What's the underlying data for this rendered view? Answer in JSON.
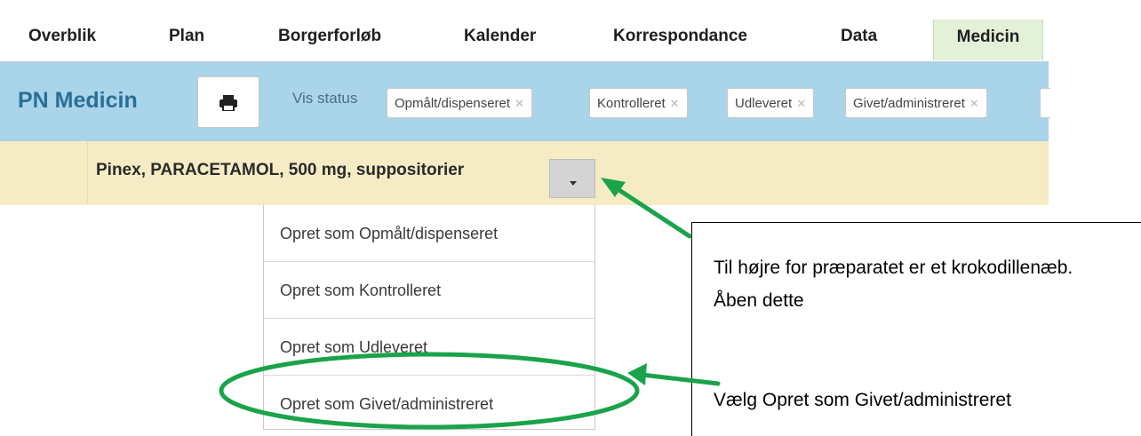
{
  "topnav": {
    "tabs": [
      {
        "label": "Overblik"
      },
      {
        "label": "Plan"
      },
      {
        "label": "Borgerforløb"
      },
      {
        "label": "Kalender"
      },
      {
        "label": "Korrespondance"
      },
      {
        "label": "Data"
      },
      {
        "label": "Medicin",
        "active": true
      }
    ]
  },
  "toolbar": {
    "title": "PN Medicin",
    "print_icon": "printer-icon",
    "vis_status_label": "Vis status",
    "status_chips": [
      {
        "label": "Opmålt/dispenseret"
      },
      {
        "label": "Kontrolleret"
      },
      {
        "label": "Udleveret"
      },
      {
        "label": "Givet/administreret"
      }
    ],
    "remove_glyph": "✕"
  },
  "medication": {
    "name": "Pinex, PARACETAMOL, 500 mg, suppositorier",
    "dropdown_icon": "caret-down-icon"
  },
  "dropdown": {
    "items": [
      {
        "label": "Opret som Opmålt/dispenseret"
      },
      {
        "label": "Opret som Kontrolleret"
      },
      {
        "label": "Opret som Udleveret"
      },
      {
        "label": "Opret som Givet/administreret",
        "highlighted": true
      }
    ]
  },
  "annotations": {
    "note1": "Til højre for præparatet er et krokodillenæb. Åben dette",
    "note2": "Vælg Opret som Givet/administreret",
    "arrow_color": "#1aa34a",
    "ellipse_color": "#1aa34a"
  },
  "colors": {
    "toolbar_bg": "#a9d4ea",
    "title_color": "#2a6f96",
    "medication_row_bg": "#f5ecc5",
    "active_tab_bg": "#e4f1d9"
  }
}
